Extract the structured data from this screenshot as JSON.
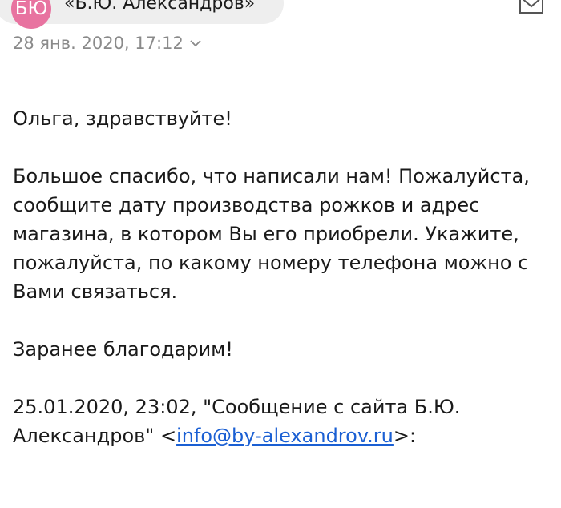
{
  "header": {
    "avatar_initials": "БЮ",
    "avatar_color": "#e873a0",
    "sender_name": "«Б.Ю. Александров»",
    "more_icon": "more-dots-icon",
    "reply_icon": "reply-icon"
  },
  "meta": {
    "date": "28 янв. 2020, 17:12",
    "chevron_icon": "chevron-down-icon"
  },
  "message": {
    "greeting": "Ольга, здравствуйте!",
    "paragraph1": "Большое спасибо, что написали нам! Пожалуйста, сообщите дату производства рожков и адрес магазина, в котором Вы его приобрели. Укажите, пожалуйста, по какому номеру телефона можно с Вами связаться.",
    "thanks": "Заранее благодарим!",
    "quote_prefix": "25.01.2020, 23:02, \"Сообщение с сайта Б.Ю. Александров\" <",
    "quote_email": "info@by-alexandrov.ru",
    "quote_suffix": ">:",
    "link_color": "#1a5fd3"
  }
}
